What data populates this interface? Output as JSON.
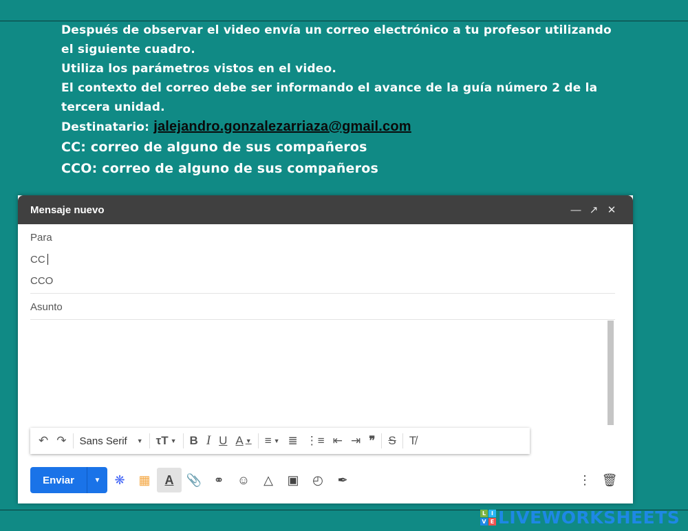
{
  "instructions": {
    "line1": "Después de observar el video envía un correo electrónico a tu profesor utilizando",
    "line2": "el siguiente cuadro.",
    "line3": "Utiliza los parámetros vistos en el video.",
    "line4": "El contexto del correo debe ser informando el avance de la guía número 2 de la",
    "line5": "tercera unidad.",
    "recipient_label": "Destinatario:",
    "recipient_email": "jalejandro.gonzalezarriaza@gmail.com",
    "cc_line": "CC: correo de alguno de sus compañeros",
    "cco_line": "CCO: correo de alguno de sus compañeros"
  },
  "compose": {
    "title": "Mensaje nuevo",
    "to_label": "Para",
    "cc_label": "CC",
    "cco_label": "CCO",
    "subject_placeholder": "Asunto",
    "font_name": "Sans Serif",
    "send_label": "Enviar"
  },
  "branding": {
    "logo_text": "LIVEWORKSHEETS",
    "logo_letters": [
      "L",
      "I",
      "V",
      "E"
    ]
  },
  "colors": {
    "background": "#108a85",
    "header": "#404040",
    "send_button": "#1a73e8",
    "logo": "#1e88e5"
  },
  "icons": [
    "undo-icon",
    "redo-icon",
    "text-size-icon",
    "bold-icon",
    "italic-icon",
    "underline-icon",
    "text-color-icon",
    "align-icon",
    "numbered-list-icon",
    "bulleted-list-icon",
    "indent-less-icon",
    "indent-more-icon",
    "quote-icon",
    "strikethrough-icon",
    "clear-formatting-icon",
    "send-options-icon",
    "confidential-icon",
    "emoji-palette-icon",
    "formatting-toggle-icon",
    "attach-icon",
    "link-icon",
    "emoji-icon",
    "drive-icon",
    "photo-icon",
    "lock-clock-icon",
    "signature-icon",
    "more-options-icon",
    "delete-icon"
  ]
}
